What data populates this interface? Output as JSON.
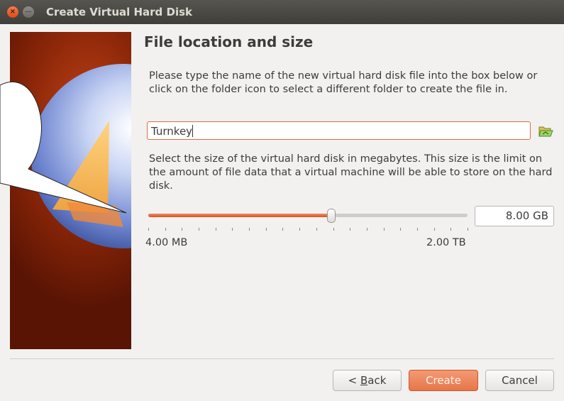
{
  "window": {
    "title": "Create Virtual Hard Disk",
    "close_glyph": "×",
    "minimize_glyph": "—"
  },
  "page": {
    "heading": "File location and size",
    "location_instructions": "Please type the name of the new virtual hard disk file into the box below or click on the folder icon to select a different folder to create the file in.",
    "file_name_value": "Turnkey",
    "folder_button_icon": "folder-open-icon",
    "size_instructions": "Select the size of the virtual hard disk in megabytes. This size is the limit on the amount of file data that a virtual machine will be able to store on the hard disk.",
    "size_value": "8.00 GB",
    "size_slider_fraction": 0.574,
    "slider_min_label": "4.00 MB",
    "slider_max_label": "2.00 TB"
  },
  "buttons": {
    "back_prefix": "< ",
    "back_mnemonic": "B",
    "back_rest": "ack",
    "create": "Create",
    "cancel": "Cancel"
  },
  "colors": {
    "accent": "#e8764a",
    "titlebar": "#4a4944",
    "close_button": "#df4a16"
  }
}
